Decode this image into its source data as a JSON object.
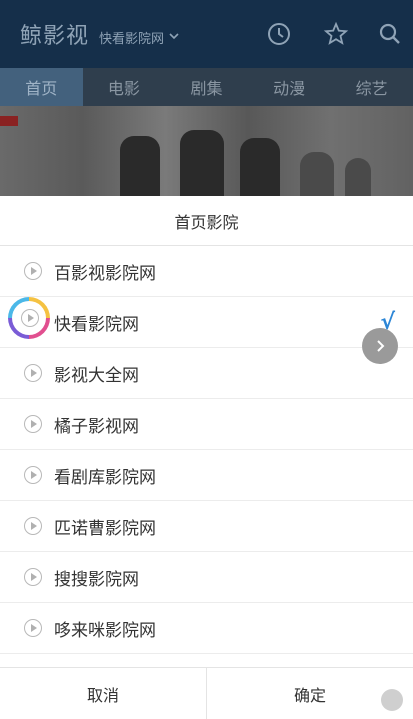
{
  "appbar": {
    "title": "鲸影视",
    "source": "快看影院网",
    "icons": [
      "clock-icon",
      "star-icon",
      "search-icon"
    ]
  },
  "tabs": [
    {
      "label": "首页",
      "active": true
    },
    {
      "label": "电影",
      "active": false
    },
    {
      "label": "剧集",
      "active": false
    },
    {
      "label": "动漫",
      "active": false
    },
    {
      "label": "综艺",
      "active": false
    }
  ],
  "dialog": {
    "title": "首页影院",
    "options": [
      {
        "label": "百影视影院网",
        "selected": false
      },
      {
        "label": "快看影院网",
        "selected": true
      },
      {
        "label": "影视大全网",
        "selected": false
      },
      {
        "label": "橘子影视网",
        "selected": false
      },
      {
        "label": "看剧库影院网",
        "selected": false
      },
      {
        "label": "匹诺曹影院网",
        "selected": false
      },
      {
        "label": "搜搜影院网",
        "selected": false
      },
      {
        "label": "哆来咪影院网",
        "selected": false
      }
    ],
    "check_mark": "√",
    "cancel_label": "取消",
    "confirm_label": "确定"
  },
  "colors": {
    "accent": "#2c86d6",
    "appbar": "#152f4a"
  }
}
